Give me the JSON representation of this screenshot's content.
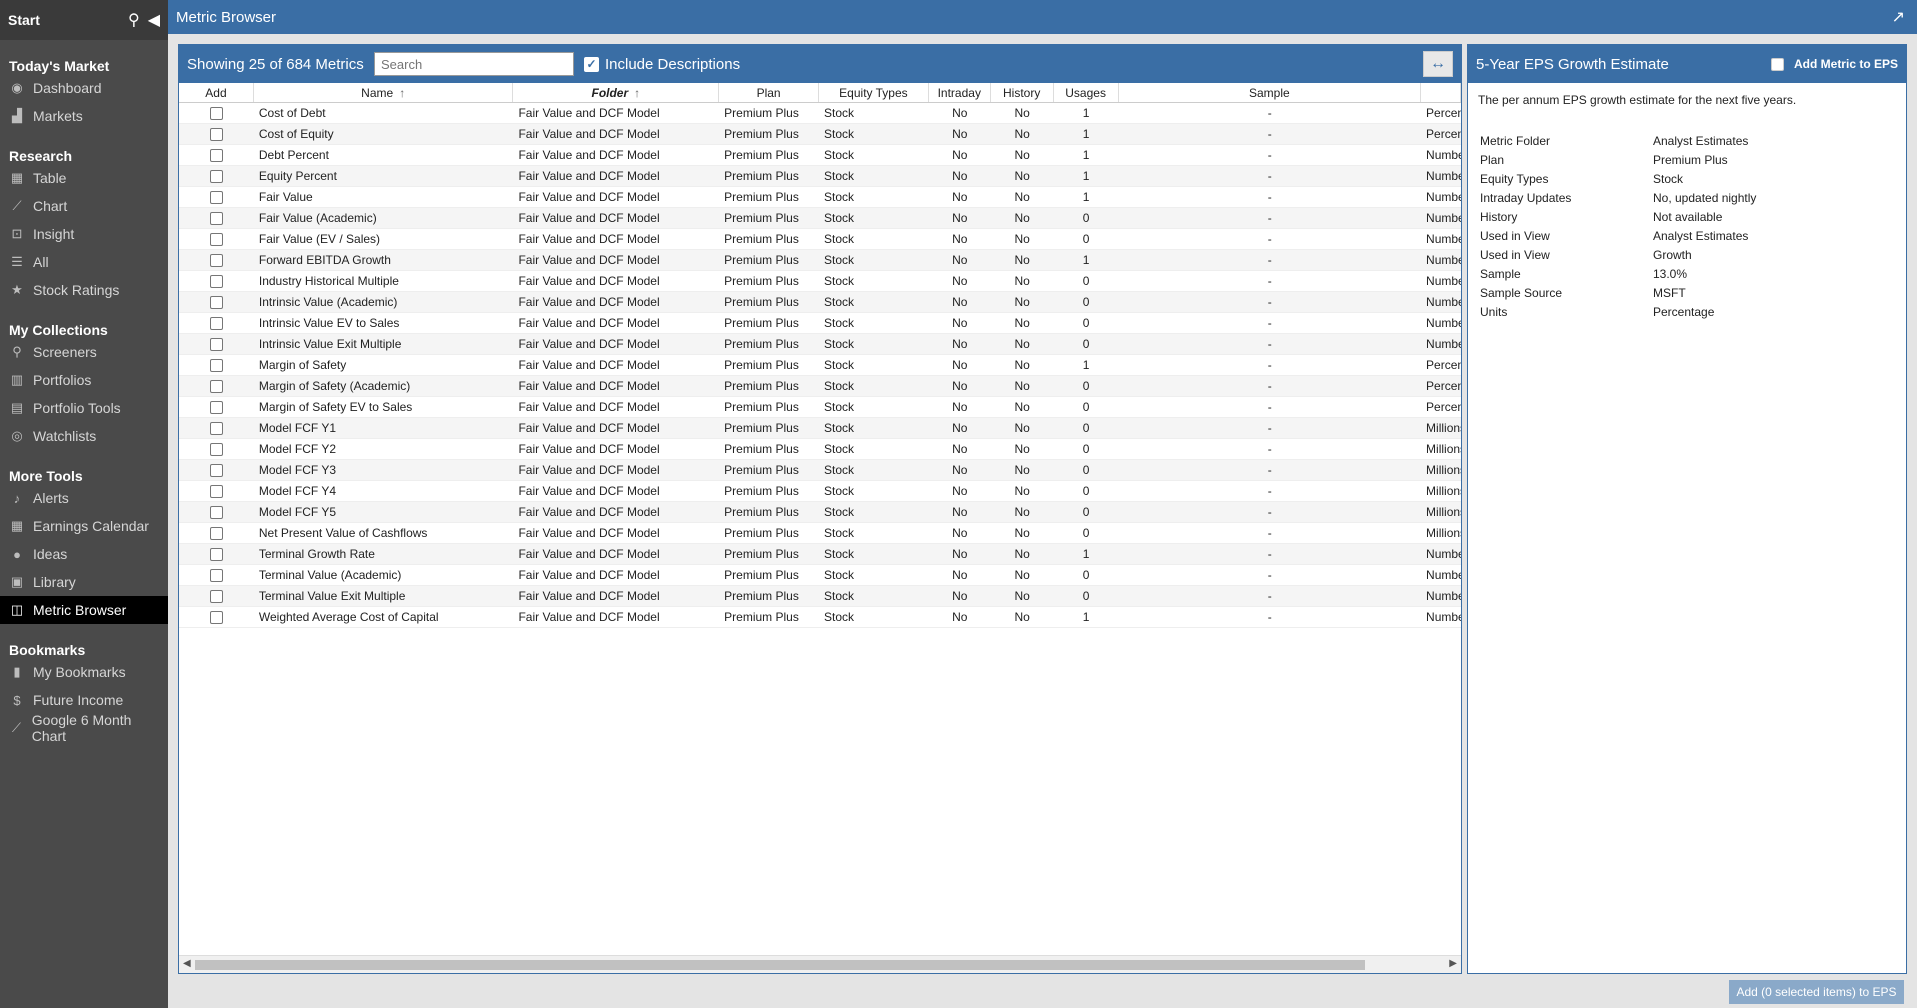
{
  "sidebar": {
    "start_label": "Start",
    "sections": [
      {
        "title": "Today's Market",
        "items": [
          {
            "label": "Dashboard",
            "icon": "dashboard-icon",
            "glyph": "◉"
          },
          {
            "label": "Markets",
            "icon": "chart-area-icon",
            "glyph": "▟"
          }
        ]
      },
      {
        "title": "Research",
        "items": [
          {
            "label": "Table",
            "icon": "table-icon",
            "glyph": "▦"
          },
          {
            "label": "Chart",
            "icon": "line-chart-icon",
            "glyph": "⟋"
          },
          {
            "label": "Insight",
            "icon": "insight-icon",
            "glyph": "⊡"
          },
          {
            "label": "All",
            "icon": "list-icon",
            "glyph": "☰"
          },
          {
            "label": "Stock Ratings",
            "icon": "star-icon",
            "glyph": "★"
          }
        ]
      },
      {
        "title": "My Collections",
        "items": [
          {
            "label": "Screeners",
            "icon": "search-icon",
            "glyph": "⚲"
          },
          {
            "label": "Portfolios",
            "icon": "portfolio-icon",
            "glyph": "▥"
          },
          {
            "label": "Portfolio Tools",
            "icon": "tools-icon",
            "glyph": "▤"
          },
          {
            "label": "Watchlists",
            "icon": "binoculars-icon",
            "glyph": "◎"
          }
        ]
      },
      {
        "title": "More Tools",
        "items": [
          {
            "label": "Alerts",
            "icon": "bell-icon",
            "glyph": "♪"
          },
          {
            "label": "Earnings Calendar",
            "icon": "calendar-icon",
            "glyph": "▦"
          },
          {
            "label": "Ideas",
            "icon": "lightbulb-icon",
            "glyph": "●"
          },
          {
            "label": "Library",
            "icon": "book-icon",
            "glyph": "▣"
          },
          {
            "label": "Metric Browser",
            "icon": "metric-browser-icon",
            "glyph": "◫",
            "active": true
          }
        ]
      },
      {
        "title": "Bookmarks",
        "items": [
          {
            "label": "My Bookmarks",
            "icon": "bookmark-icon",
            "glyph": "▮"
          },
          {
            "label": "Future Income",
            "icon": "dollar-icon",
            "glyph": "$"
          },
          {
            "label": "Google 6 Month Chart",
            "icon": "line-chart-icon",
            "glyph": "⟋"
          }
        ]
      }
    ]
  },
  "topbar": {
    "title": "Metric Browser"
  },
  "main": {
    "count_label": "Showing 25 of 684 Metrics",
    "search_placeholder": "Search",
    "include_descriptions_label": "Include Descriptions",
    "columns": {
      "add": "Add",
      "name": "Name",
      "folder": "Folder",
      "plan": "Plan",
      "equity": "Equity Types",
      "intraday": "Intraday",
      "history": "History",
      "usages": "Usages",
      "sample": "Sample"
    },
    "rows": [
      {
        "name": "Cost of Debt",
        "folder": "Fair Value and DCF Model",
        "plan": "Premium Plus",
        "equity": "Stock",
        "intraday": "No",
        "history": "No",
        "usages": "1",
        "sample": "-",
        "units": "Percentage"
      },
      {
        "name": "Cost of Equity",
        "folder": "Fair Value and DCF Model",
        "plan": "Premium Plus",
        "equity": "Stock",
        "intraday": "No",
        "history": "No",
        "usages": "1",
        "sample": "-",
        "units": "Percentage"
      },
      {
        "name": "Debt Percent",
        "folder": "Fair Value and DCF Model",
        "plan": "Premium Plus",
        "equity": "Stock",
        "intraday": "No",
        "history": "No",
        "usages": "1",
        "sample": "-",
        "units": "Number"
      },
      {
        "name": "Equity Percent",
        "folder": "Fair Value and DCF Model",
        "plan": "Premium Plus",
        "equity": "Stock",
        "intraday": "No",
        "history": "No",
        "usages": "1",
        "sample": "-",
        "units": "Number"
      },
      {
        "name": "Fair Value",
        "folder": "Fair Value and DCF Model",
        "plan": "Premium Plus",
        "equity": "Stock",
        "intraday": "No",
        "history": "No",
        "usages": "1",
        "sample": "-",
        "units": "Number"
      },
      {
        "name": "Fair Value (Academic)",
        "folder": "Fair Value and DCF Model",
        "plan": "Premium Plus",
        "equity": "Stock",
        "intraday": "No",
        "history": "No",
        "usages": "0",
        "sample": "-",
        "units": "Number"
      },
      {
        "name": "Fair Value (EV / Sales)",
        "folder": "Fair Value and DCF Model",
        "plan": "Premium Plus",
        "equity": "Stock",
        "intraday": "No",
        "history": "No",
        "usages": "0",
        "sample": "-",
        "units": "Number"
      },
      {
        "name": "Forward EBITDA Growth",
        "folder": "Fair Value and DCF Model",
        "plan": "Premium Plus",
        "equity": "Stock",
        "intraday": "No",
        "history": "No",
        "usages": "1",
        "sample": "-",
        "units": "Number"
      },
      {
        "name": "Industry Historical Multiple",
        "folder": "Fair Value and DCF Model",
        "plan": "Premium Plus",
        "equity": "Stock",
        "intraday": "No",
        "history": "No",
        "usages": "0",
        "sample": "-",
        "units": "Number"
      },
      {
        "name": "Intrinsic Value (Academic)",
        "folder": "Fair Value and DCF Model",
        "plan": "Premium Plus",
        "equity": "Stock",
        "intraday": "No",
        "history": "No",
        "usages": "0",
        "sample": "-",
        "units": "Number"
      },
      {
        "name": "Intrinsic Value EV to Sales",
        "folder": "Fair Value and DCF Model",
        "plan": "Premium Plus",
        "equity": "Stock",
        "intraday": "No",
        "history": "No",
        "usages": "0",
        "sample": "-",
        "units": "Number"
      },
      {
        "name": "Intrinsic Value Exit Multiple",
        "folder": "Fair Value and DCF Model",
        "plan": "Premium Plus",
        "equity": "Stock",
        "intraday": "No",
        "history": "No",
        "usages": "0",
        "sample": "-",
        "units": "Number"
      },
      {
        "name": "Margin of Safety",
        "folder": "Fair Value and DCF Model",
        "plan": "Premium Plus",
        "equity": "Stock",
        "intraday": "No",
        "history": "No",
        "usages": "1",
        "sample": "-",
        "units": "Percentage"
      },
      {
        "name": "Margin of Safety (Academic)",
        "folder": "Fair Value and DCF Model",
        "plan": "Premium Plus",
        "equity": "Stock",
        "intraday": "No",
        "history": "No",
        "usages": "0",
        "sample": "-",
        "units": "Percentage"
      },
      {
        "name": "Margin of Safety EV to Sales",
        "folder": "Fair Value and DCF Model",
        "plan": "Premium Plus",
        "equity": "Stock",
        "intraday": "No",
        "history": "No",
        "usages": "0",
        "sample": "-",
        "units": "Percentage"
      },
      {
        "name": "Model FCF Y1",
        "folder": "Fair Value and DCF Model",
        "plan": "Premium Plus",
        "equity": "Stock",
        "intraday": "No",
        "history": "No",
        "usages": "0",
        "sample": "-",
        "units": "Millions"
      },
      {
        "name": "Model FCF Y2",
        "folder": "Fair Value and DCF Model",
        "plan": "Premium Plus",
        "equity": "Stock",
        "intraday": "No",
        "history": "No",
        "usages": "0",
        "sample": "-",
        "units": "Millions"
      },
      {
        "name": "Model FCF Y3",
        "folder": "Fair Value and DCF Model",
        "plan": "Premium Plus",
        "equity": "Stock",
        "intraday": "No",
        "history": "No",
        "usages": "0",
        "sample": "-",
        "units": "Millions"
      },
      {
        "name": "Model FCF Y4",
        "folder": "Fair Value and DCF Model",
        "plan": "Premium Plus",
        "equity": "Stock",
        "intraday": "No",
        "history": "No",
        "usages": "0",
        "sample": "-",
        "units": "Millions"
      },
      {
        "name": "Model FCF Y5",
        "folder": "Fair Value and DCF Model",
        "plan": "Premium Plus",
        "equity": "Stock",
        "intraday": "No",
        "history": "No",
        "usages": "0",
        "sample": "-",
        "units": "Millions"
      },
      {
        "name": "Net Present Value of Cashflows",
        "folder": "Fair Value and DCF Model",
        "plan": "Premium Plus",
        "equity": "Stock",
        "intraday": "No",
        "history": "No",
        "usages": "0",
        "sample": "-",
        "units": "Millions"
      },
      {
        "name": "Terminal Growth Rate",
        "folder": "Fair Value and DCF Model",
        "plan": "Premium Plus",
        "equity": "Stock",
        "intraday": "No",
        "history": "No",
        "usages": "1",
        "sample": "-",
        "units": "Number"
      },
      {
        "name": "Terminal Value (Academic)",
        "folder": "Fair Value and DCF Model",
        "plan": "Premium Plus",
        "equity": "Stock",
        "intraday": "No",
        "history": "No",
        "usages": "0",
        "sample": "-",
        "units": "Number"
      },
      {
        "name": "Terminal Value Exit Multiple",
        "folder": "Fair Value and DCF Model",
        "plan": "Premium Plus",
        "equity": "Stock",
        "intraday": "No",
        "history": "No",
        "usages": "0",
        "sample": "-",
        "units": "Number"
      },
      {
        "name": "Weighted Average Cost of Capital",
        "folder": "Fair Value and DCF Model",
        "plan": "Premium Plus",
        "equity": "Stock",
        "intraday": "No",
        "history": "No",
        "usages": "1",
        "sample": "-",
        "units": "Number"
      }
    ]
  },
  "detail": {
    "title": "5-Year EPS Growth Estimate",
    "add_label": "Add Metric to EPS",
    "description": "The per annum EPS growth estimate for the next five years.",
    "properties": [
      {
        "key": "Metric Folder",
        "value": "Analyst Estimates"
      },
      {
        "key": "Plan",
        "value": "Premium Plus"
      },
      {
        "key": "Equity Types",
        "value": "Stock"
      },
      {
        "key": "Intraday Updates",
        "value": "No, updated nightly"
      },
      {
        "key": "History",
        "value": "Not available"
      },
      {
        "key": "Used in View",
        "value": "Analyst Estimates"
      },
      {
        "key": "Used in View",
        "value": "Growth"
      },
      {
        "key": "Sample",
        "value": "13.0%"
      },
      {
        "key": "Sample Source",
        "value": "MSFT"
      },
      {
        "key": "Units",
        "value": "Percentage"
      }
    ]
  },
  "footer": {
    "add_button_label": "Add (0 selected items) to EPS"
  },
  "colors": {
    "accent": "#3a6ea5",
    "sidebar_bg": "#4a4a4a",
    "sidebar_active": "#000000"
  }
}
